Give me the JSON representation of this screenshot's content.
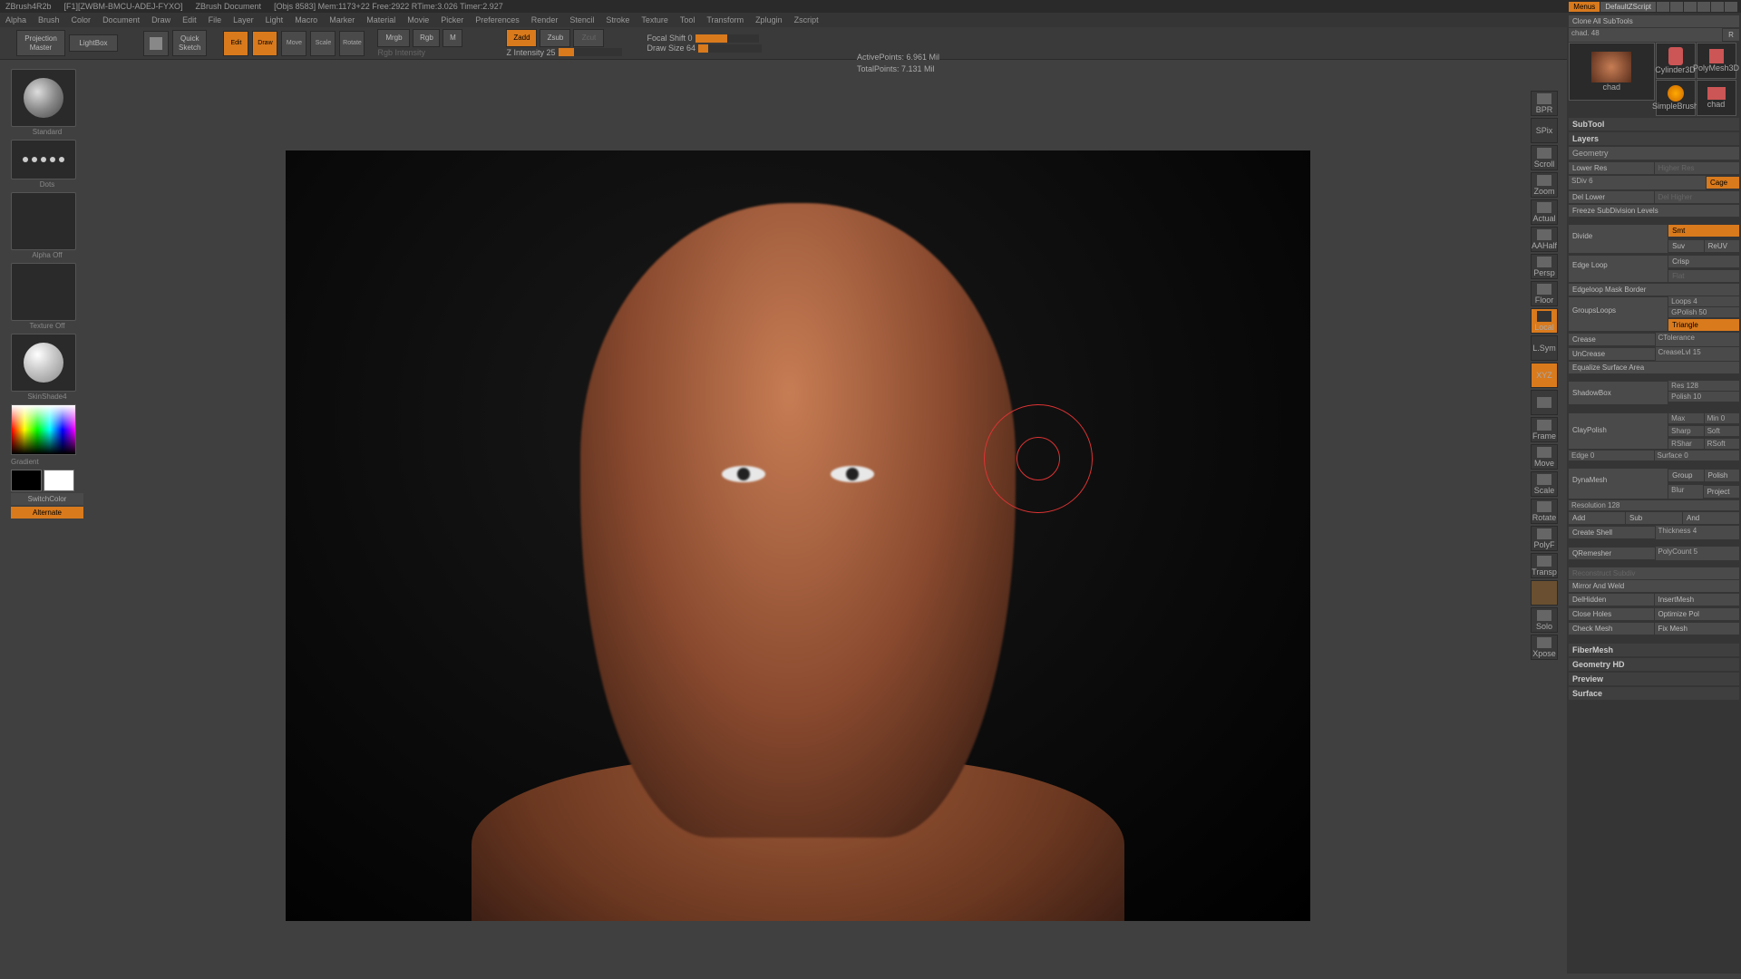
{
  "title": {
    "app": "ZBrush4R2b",
    "file": "[F1][ZWBM-BMCU-ADEJ-FYXO]",
    "doc": "ZBrush Document",
    "objs": "[Objs 8583] Mem:1173+22  Free:2922  RTime:3.026  Timer:2.927"
  },
  "menus_btn": "Menus",
  "default_script": "DefaultZScript",
  "mainmenu": [
    "Alpha",
    "Brush",
    "Color",
    "Document",
    "Draw",
    "Edit",
    "File",
    "Layer",
    "Light",
    "Macro",
    "Marker",
    "Material",
    "Movie",
    "Picker",
    "Preferences",
    "Render",
    "Stencil",
    "Stroke",
    "Texture",
    "Tool",
    "Transform",
    "Zplugin",
    "Zscript"
  ],
  "toolbar": {
    "projection": "Projection\nMaster",
    "lightbox": "LightBox",
    "quicksketch": "Quick\nSketch",
    "edit": "Edit",
    "draw": "Draw",
    "move": "Move",
    "scale": "Scale",
    "rotate": "Rotate",
    "mrgb": "Mrgb",
    "rgb": "Rgb",
    "m": "M",
    "rgb_int": "Rgb Intensity",
    "zadd": "Zadd",
    "zsub": "Zsub",
    "zcut": "Zcut",
    "zint": "Z Intensity 25",
    "focal": "Focal Shift 0",
    "drawsize": "Draw Size 64"
  },
  "stats": {
    "active": "ActivePoints: 6.961  Mil",
    "total": "TotalPoints: 7.131  Mil"
  },
  "left": {
    "brush": "Standard",
    "stroke": "Dots",
    "alpha": "Alpha Off",
    "texture": "Texture Off",
    "material": "SkinShade4",
    "gradient": "Gradient",
    "switch": "SwitchColor",
    "alternate": "Alternate"
  },
  "rbar": [
    "BPR",
    "SPix",
    "Scroll",
    "Zoom",
    "Actual",
    "AAHalf",
    "Persp",
    "Floor",
    "Local",
    "L.Sym",
    "XYZ",
    "Frame",
    "Move",
    "Scale",
    "Rotate",
    "PolyF",
    "Transp",
    "Solo",
    "Xpose"
  ],
  "rp": {
    "clone": "Clone All SubTools",
    "name": "chad. 48",
    "r": "R",
    "thumbs": [
      {
        "l": "chad"
      },
      {
        "l": "Cylinder3D"
      },
      {
        "l": "SimpleBrush"
      },
      {
        "l": "PolyMesh3D"
      },
      {
        "l": "chad"
      }
    ],
    "sections": {
      "subtool": "SubTool",
      "layers": "Layers",
      "geometry": "Geometry",
      "fibermesh": "FiberMesh",
      "geomhd": "Geometry HD",
      "preview": "Preview",
      "surface": "Surface"
    },
    "geo": {
      "lower": "Lower Res",
      "higher": "Higher Res",
      "sdiv": "SDiv 6",
      "cage": "Cage",
      "dellower": "Del Lower",
      "delhigher": "Del Higher",
      "freeze": "Freeze SubDivision Levels",
      "divide": "Divide",
      "smt": "Smt",
      "suv": "Suv",
      "reuv": "ReUV",
      "crisp": "Crisp",
      "flat": "Flat",
      "edgeloop": "Edge Loop",
      "edgemask": "Edgeloop Mask Border",
      "groupsloops": "GroupsLoops",
      "loops": "Loops 4",
      "gpolish": "GPolish 50",
      "triangle": "Triangle",
      "crease": "Crease",
      "uncrease": "UnCrease",
      "ctol": "CTolerance",
      "creaselvl": "CreaseLvl 15",
      "equalize": "Equalize Surface Area",
      "shadowbox": "ShadowBox",
      "res": "Res 128",
      "polish": "Polish 10",
      "claypolish": "ClayPolish",
      "max": "Max",
      "min": "Min 0",
      "sharp": "Sharp",
      "soft": "Soft",
      "rshar": "RShar",
      "rsoft": "RSoft",
      "edge": "Edge 0",
      "surface": "Surface 0",
      "dynamesh": "DynaMesh",
      "group": "Group",
      "polishd": "Polish",
      "blur": "Blur",
      "project": "Project",
      "resolution": "Resolution 128",
      "add": "Add",
      "sub": "Sub",
      "and": "And",
      "shell": "Create Shell",
      "thickness": "Thickness 4",
      "qremesh": "QRemesher",
      "polycount": "PolyCount 5",
      "reconstruct": "Reconstruct Subdiv",
      "mirror": "Mirror And Weld",
      "delhidden": "DelHidden",
      "insert": "InsertMesh",
      "closeholes": "Close Holes",
      "optimize": "Optimize Pol",
      "checkmesh": "Check Mesh",
      "fixmesh": "Fix Mesh"
    }
  }
}
